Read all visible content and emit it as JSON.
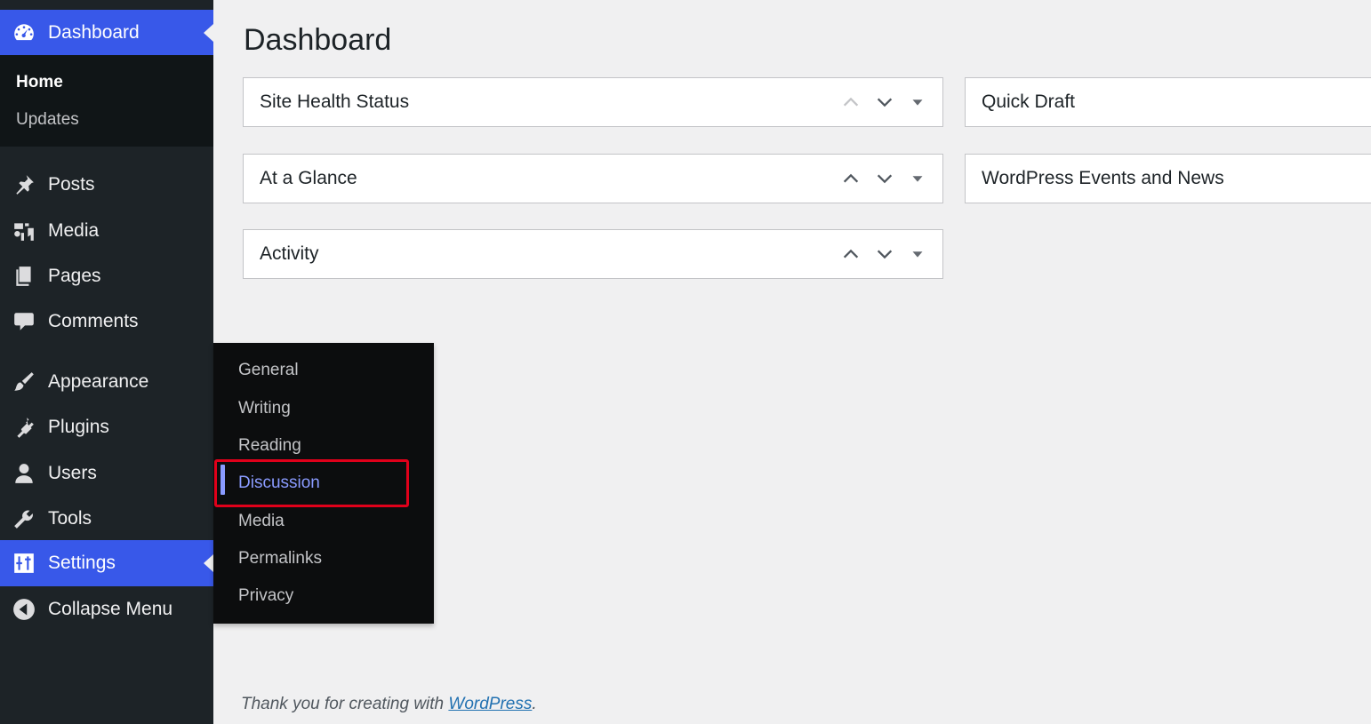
{
  "sidebar": {
    "dashboard_label": "Dashboard",
    "submenu": {
      "home": "Home",
      "updates": "Updates"
    },
    "items": [
      {
        "id": "posts",
        "label": "Posts",
        "icon": "pushpin-icon"
      },
      {
        "id": "media",
        "label": "Media",
        "icon": "media-icon"
      },
      {
        "id": "pages",
        "label": "Pages",
        "icon": "pages-icon"
      },
      {
        "id": "comments",
        "label": "Comments",
        "icon": "comment-icon"
      },
      {
        "id": "appearance",
        "label": "Appearance",
        "icon": "paintbrush-icon"
      },
      {
        "id": "plugins",
        "label": "Plugins",
        "icon": "plug-icon"
      },
      {
        "id": "users",
        "label": "Users",
        "icon": "user-icon"
      },
      {
        "id": "tools",
        "label": "Tools",
        "icon": "wrench-icon"
      },
      {
        "id": "settings",
        "label": "Settings",
        "icon": "sliders-icon"
      },
      {
        "id": "collapse",
        "label": "Collapse Menu",
        "icon": "collapse-arrow-icon"
      }
    ],
    "active_item": "settings"
  },
  "settings_flyout": {
    "items": [
      "General",
      "Writing",
      "Reading",
      "Discussion",
      "Media",
      "Permalinks",
      "Privacy"
    ],
    "selected": "Discussion"
  },
  "main": {
    "title": "Dashboard",
    "widgets_left": [
      "Site Health Status",
      "At a Glance",
      "Activity"
    ],
    "widgets_right": [
      "Quick Draft",
      "WordPress Events and News"
    ]
  },
  "footer": {
    "text": "Thank you for creating with ",
    "link": "WordPress",
    "end": "."
  },
  "colors": {
    "sidebar_bg": "#1d2327",
    "accent": "#3858e9",
    "flyout_selected": "#8a9bff",
    "highlight_border": "#e0001a"
  }
}
